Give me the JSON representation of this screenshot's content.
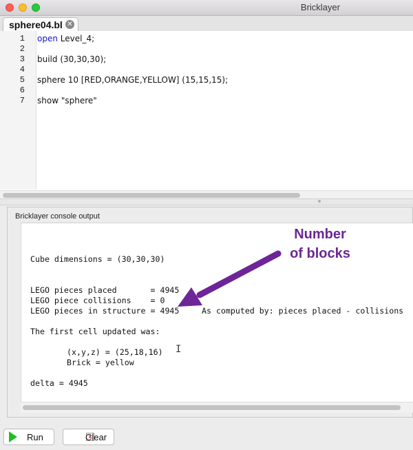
{
  "window": {
    "title": "Bricklayer"
  },
  "tab": {
    "filename": "sphere04.bl",
    "close_glyph": "⊗"
  },
  "editor": {
    "line_numbers": [
      "1",
      "2",
      "3",
      "4",
      "5",
      "6",
      "7"
    ],
    "keyword": "open",
    "line1_rest": " Level_4;",
    "line3": "build (30,30,30);",
    "line5": "sphere 10 [RED,ORANGE,YELLOW] (15,15,15);",
    "line7": "show \"sphere\""
  },
  "console": {
    "panel_title": "Bricklayer console output",
    "lines": {
      "cube": "Cube dimensions = (30,30,30)",
      "placed": "LEGO pieces placed       = 4945",
      "collisions": "LEGO piece collisions    = 0",
      "structure": "LEGO pieces in structure = 4945",
      "computed": "As computed by: pieces placed - collisions",
      "first_cell": "The first cell updated was:",
      "coords": "(x,y,z) = (25,18,16)",
      "brick": "Brick = yellow",
      "delta": "delta = 4945"
    }
  },
  "annotation": {
    "line1": "Number",
    "line2": "of blocks",
    "color": "#6d2597"
  },
  "buttons": {
    "run": "Run",
    "clear": "Clear"
  },
  "icons": {
    "run": "run-triangle-icon",
    "clear": "clear-x-icon",
    "close": "close-tab-icon"
  }
}
